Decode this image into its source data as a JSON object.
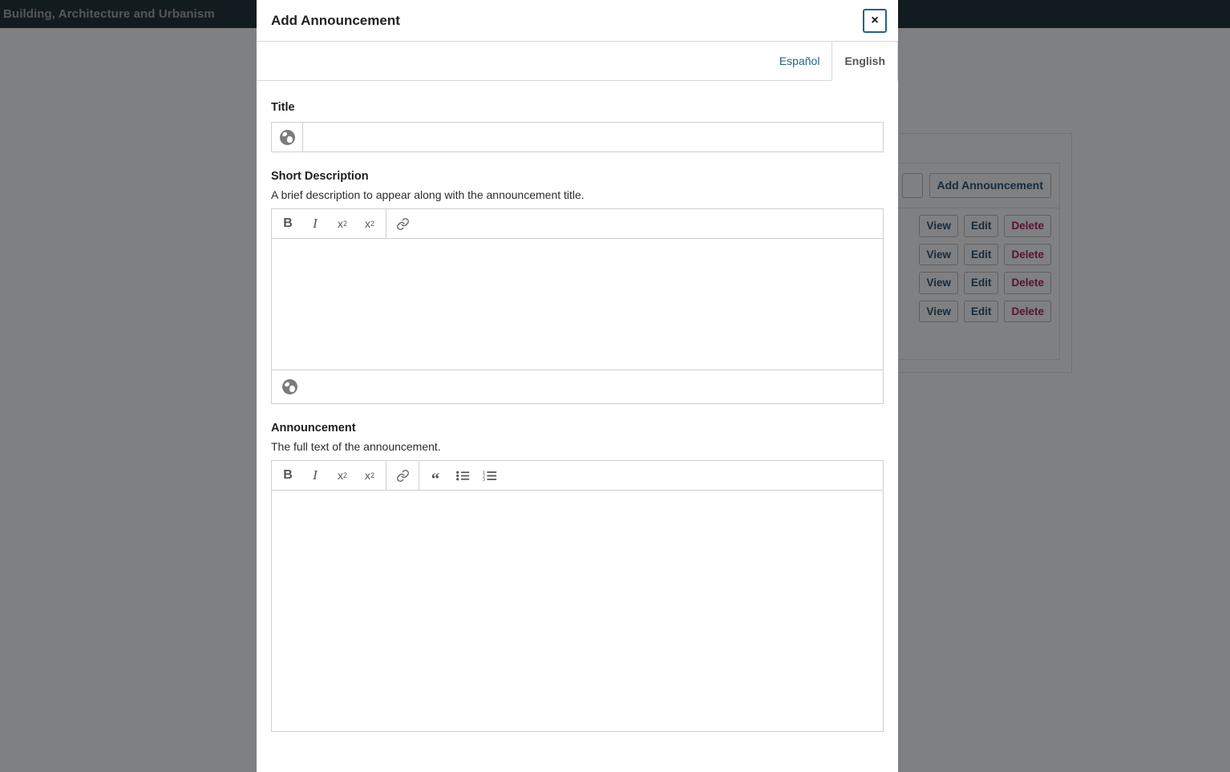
{
  "topbar": {
    "brand": "Building, Architecture and Urbanism"
  },
  "background_panel": {
    "add_button": "Add Announcement",
    "row_actions": [
      "View",
      "Edit",
      "Delete"
    ],
    "rows": [
      {
        "view": "View",
        "edit": "Edit",
        "delete": "Delete"
      },
      {
        "view": "View",
        "edit": "Edit",
        "delete": "Delete"
      },
      {
        "view": "View",
        "edit": "Edit",
        "delete": "Delete"
      },
      {
        "view": "View",
        "edit": "Edit",
        "delete": "Delete"
      }
    ]
  },
  "modal": {
    "title": "Add Announcement",
    "close_label": "×",
    "tabs": [
      {
        "label": "Español",
        "active": false
      },
      {
        "label": "English",
        "active": true
      }
    ],
    "fields": {
      "title": {
        "label": "Title",
        "value": "",
        "placeholder": "",
        "locale_icon": "globe-icon"
      },
      "short_description": {
        "label": "Short Description",
        "help": "A brief description to appear along with the announcement title.",
        "value": "",
        "toolbar": [
          {
            "name": "bold",
            "glyph": "B"
          },
          {
            "name": "italic",
            "glyph": "I"
          },
          {
            "name": "superscript",
            "glyph": "x²"
          },
          {
            "name": "subscript",
            "glyph": "x₂"
          },
          {
            "name": "link",
            "glyph": "🔗"
          }
        ],
        "locale_icon": "globe-icon"
      },
      "announcement": {
        "label": "Announcement",
        "help": "The full text of the announcement.",
        "value": "",
        "toolbar": [
          {
            "name": "bold",
            "glyph": "B"
          },
          {
            "name": "italic",
            "glyph": "I"
          },
          {
            "name": "superscript",
            "glyph": "x²"
          },
          {
            "name": "subscript",
            "glyph": "x₂"
          },
          {
            "name": "link",
            "glyph": "🔗"
          },
          {
            "name": "blockquote",
            "glyph": "“"
          },
          {
            "name": "bulleted-list",
            "glyph": "•≡"
          },
          {
            "name": "numbered-list",
            "glyph": "1≡"
          }
        ]
      }
    }
  },
  "colors": {
    "topbar_bg": "#04171f",
    "overlay": "#74777a",
    "link": "#1f6290",
    "danger": "#a8004c",
    "button_text": "#0e3a5c",
    "border": "#cfcfcf"
  }
}
